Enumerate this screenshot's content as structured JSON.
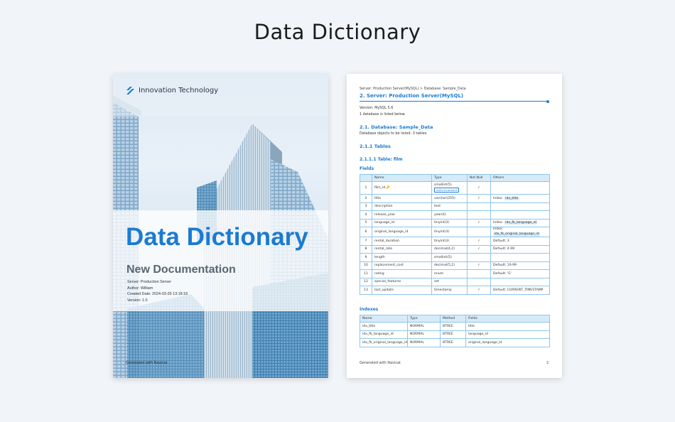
{
  "heading": "Data Dictionary",
  "cover": {
    "brand": "Innovation Technology",
    "title": "Data Dictionary",
    "subtitle": "New Documentation",
    "meta": [
      "Server: Production Server",
      "Author: William",
      "Created Date: 2024-03-26 13:18:18",
      "Version: 1.0"
    ],
    "footer": "Generated with Navicat"
  },
  "page": {
    "breadcrumb": "Server: Production Server(MySQL) > Database: Sample_Data",
    "section_title": "2. Server: Production Server(MySQL)",
    "version": "Version: MySQL 5.6",
    "db_count": "1 database is listed below.",
    "db_heading": "2.1. Database: Sample_Data",
    "db_objects": "Database objects to be listed: 3 tables",
    "tables_heading": "2.1.1 Tables",
    "table_heading": "2.1.1.1 Table: film",
    "fields_heading": "Fields",
    "fields_columns": [
      "",
      "Name",
      "Type",
      "Not Null",
      "Others"
    ],
    "fields_rows": [
      {
        "n": "1",
        "name": "film_id",
        "type": "smallint(5)",
        "badge": "Auto increment",
        "nn": "✓",
        "others": "",
        "tag": ""
      },
      {
        "n": "2",
        "name": "title",
        "type": "varchar(255)",
        "badge": "",
        "nn": "✓",
        "others": "Index:",
        "tag": "idx_title"
      },
      {
        "n": "3",
        "name": "description",
        "type": "text",
        "badge": "",
        "nn": "",
        "others": "",
        "tag": ""
      },
      {
        "n": "4",
        "name": "release_year",
        "type": "year(4)",
        "badge": "",
        "nn": "",
        "others": "",
        "tag": ""
      },
      {
        "n": "5",
        "name": "language_id",
        "type": "tinyint(3)",
        "badge": "",
        "nn": "✓",
        "others": "Index:",
        "tag": "idx_fk_language_id"
      },
      {
        "n": "6",
        "name": "original_language_id",
        "type": "tinyint(3)",
        "badge": "",
        "nn": "",
        "others": "Index:",
        "tag": "idx_fk_original_language_id"
      },
      {
        "n": "7",
        "name": "rental_duration",
        "type": "tinyint(3)",
        "badge": "",
        "nn": "✓",
        "others": "Default: 3",
        "tag": ""
      },
      {
        "n": "8",
        "name": "rental_rate",
        "type": "decimal(4,2)",
        "badge": "",
        "nn": "✓",
        "others": "Default: 4.99",
        "tag": ""
      },
      {
        "n": "9",
        "name": "length",
        "type": "smallint(5)",
        "badge": "",
        "nn": "",
        "others": "",
        "tag": ""
      },
      {
        "n": "10",
        "name": "replacement_cost",
        "type": "decimal(5,2)",
        "badge": "",
        "nn": "✓",
        "others": "Default: 19.99",
        "tag": ""
      },
      {
        "n": "11",
        "name": "rating",
        "type": "enum",
        "badge": "",
        "nn": "",
        "others": "Default: 'G'",
        "tag": ""
      },
      {
        "n": "12",
        "name": "special_features",
        "type": "set",
        "badge": "",
        "nn": "",
        "others": "",
        "tag": ""
      },
      {
        "n": "13",
        "name": "last_update",
        "type": "timestamp",
        "badge": "",
        "nn": "✓",
        "others": "Default: CURRENT_TIMESTAMP",
        "tag": ""
      }
    ],
    "indexes_heading": "Indexes",
    "indexes_columns": [
      "Name",
      "Type",
      "Method",
      "Fields"
    ],
    "indexes_rows": [
      [
        "idx_title",
        "NORMAL",
        "BTREE",
        "title"
      ],
      [
        "idx_fk_language_id",
        "NORMAL",
        "BTREE",
        "language_id"
      ],
      [
        "idx_fk_original_language_id",
        "NORMAL",
        "BTREE",
        "original_language_id"
      ]
    ],
    "footer": "Generated with Navicat",
    "page_number": "2"
  },
  "colors": {
    "accent": "#1b7bd1",
    "table_header": "#d6ebf9",
    "table_border": "#8ec5ea",
    "subtitle": "#5a6571"
  }
}
